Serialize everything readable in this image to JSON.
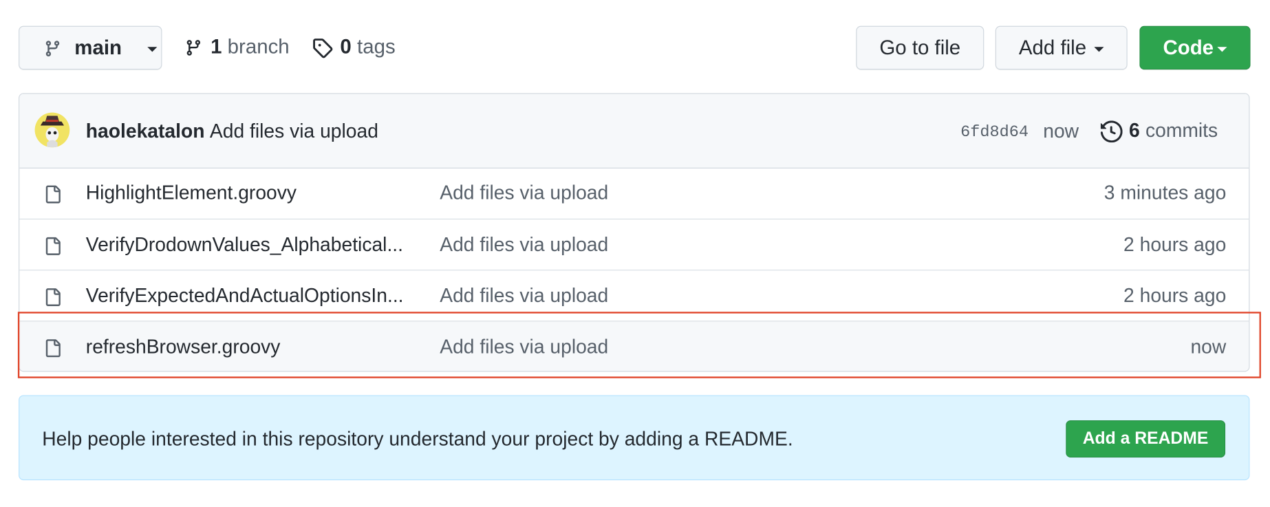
{
  "toolbar": {
    "branch_select": "main",
    "branches_count": "1",
    "branches_label": "branch",
    "tags_count": "0",
    "tags_label": "tags",
    "go_to_file": "Go to file",
    "add_file": "Add file",
    "code": "Code"
  },
  "latest_commit": {
    "author": "haolekatalon",
    "message": "Add files via upload",
    "sha": "6fd8d64",
    "time": "now",
    "commits_count": "6",
    "commits_label": "commits"
  },
  "files": [
    {
      "name": "HighlightElement.groovy",
      "message": "Add files via upload",
      "time": "3 minutes ago",
      "icon": "file-icon"
    },
    {
      "name": "VerifyDrodownValues_Alphabetical...",
      "message": "Add files via upload",
      "time": "2 hours ago",
      "icon": "file-icon"
    },
    {
      "name": "VerifyExpectedAndActualOptionsIn...",
      "message": "Add files via upload",
      "time": "2 hours ago",
      "icon": "file-icon"
    },
    {
      "name": "refreshBrowser.groovy",
      "message": "Add files via upload",
      "time": "now",
      "icon": "file-icon"
    }
  ],
  "readme_banner": {
    "text": "Help people interested in this repository understand your project by adding a README.",
    "button": "Add a README"
  },
  "colors": {
    "primary_button": "#2da44e",
    "highlight_border": "#e0452a",
    "banner_background": "#ddf4ff"
  }
}
